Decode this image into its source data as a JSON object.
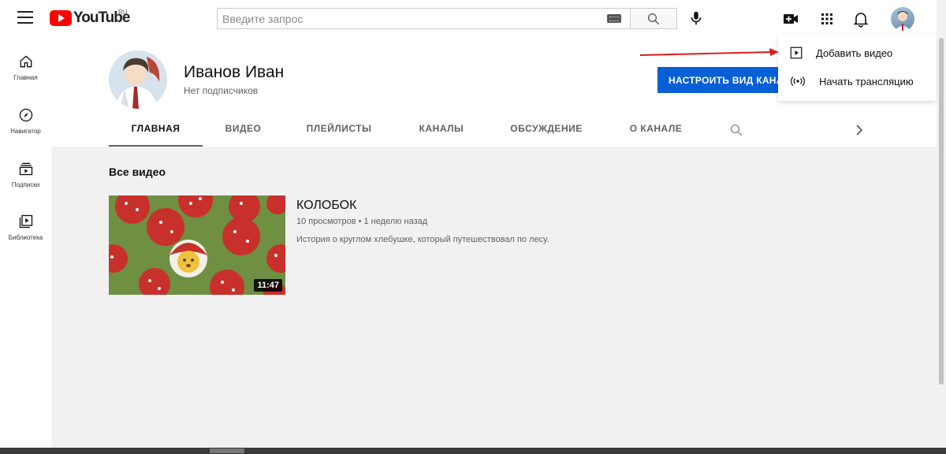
{
  "header": {
    "logo_text": "YouTube",
    "region": "RU",
    "search_placeholder": "Введите запрос"
  },
  "sidebar": {
    "items": [
      {
        "label": "Главная",
        "icon": "home-icon"
      },
      {
        "label": "Навигатор",
        "icon": "compass-icon"
      },
      {
        "label": "Подписки",
        "icon": "subscriptions-icon"
      },
      {
        "label": "Библиотека",
        "icon": "library-icon"
      }
    ]
  },
  "channel": {
    "name": "Иванов Иван",
    "subscribers": "Нет подписчиков",
    "customize_label": "НАСТРОИТЬ ВИД КАНАЛА"
  },
  "tabs": [
    "ГЛАВНАЯ",
    "ВИДЕО",
    "ПЛЕЙЛИСТЫ",
    "КАНАЛЫ",
    "ОБСУЖДЕНИЕ",
    "О КАНАЛЕ"
  ],
  "content": {
    "section_title": "Все видео",
    "video": {
      "title": "КОЛОБОК",
      "meta": "10 просмотров • 1 неделю назад",
      "description": "История о круглом хлебушке, который путешествовал по лесу.",
      "duration": "11:47"
    }
  },
  "menu": {
    "items": [
      {
        "label": "Добавить видео",
        "icon": "upload-video-icon"
      },
      {
        "label": "Начать трансляцию",
        "icon": "live-broadcast-icon"
      }
    ]
  },
  "colors": {
    "brand": "#ff0000",
    "accent_button": "#065fd4",
    "annotation_arrow": "#e01b1b"
  }
}
